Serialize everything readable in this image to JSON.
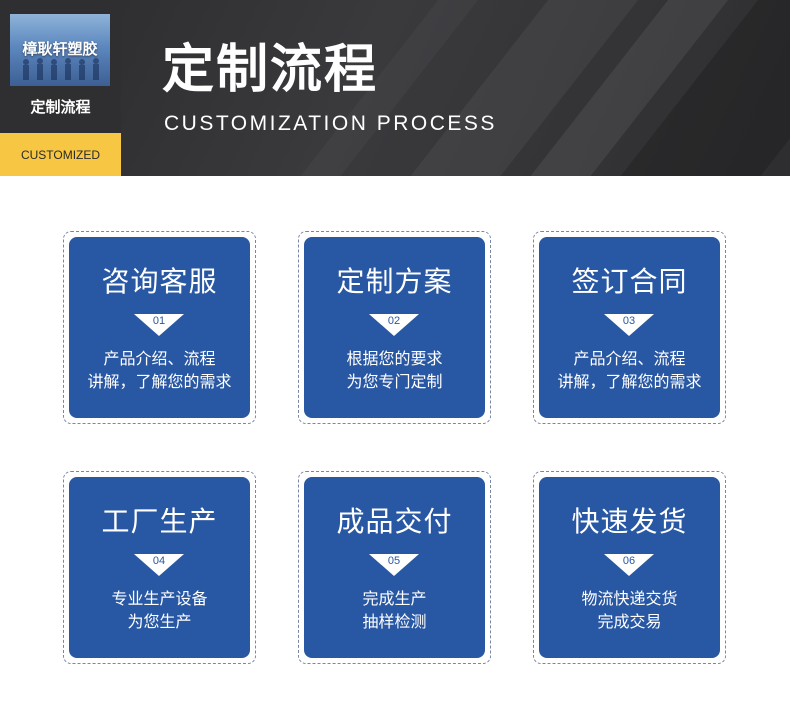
{
  "header": {
    "logo_text": "樟耿轩塑胶",
    "side_subtitle": "定制流程",
    "tag": "CUSTOMIZED",
    "title": "定制流程",
    "subtitle": "CUSTOMIZATION PROCESS"
  },
  "colors": {
    "card_blue": "#2857a3",
    "tag_yellow": "#f7c744",
    "header_dark": "#333335"
  },
  "steps": [
    {
      "title": "咨询客服",
      "num": "01",
      "line1": "产品介绍、流程",
      "line2": "讲解，了解您的需求"
    },
    {
      "title": "定制方案",
      "num": "02",
      "line1": "根据您的要求",
      "line2": "为您专门定制"
    },
    {
      "title": "签订合同",
      "num": "03",
      "line1": "产品介绍、流程",
      "line2": "讲解，了解您的需求"
    },
    {
      "title": "工厂生产",
      "num": "04",
      "line1": "专业生产设备",
      "line2": "为您生产"
    },
    {
      "title": "成品交付",
      "num": "05",
      "line1": "完成生产",
      "line2": "抽样检测"
    },
    {
      "title": "快速发货",
      "num": "06",
      "line1": "物流快递交货",
      "line2": "完成交易"
    }
  ]
}
